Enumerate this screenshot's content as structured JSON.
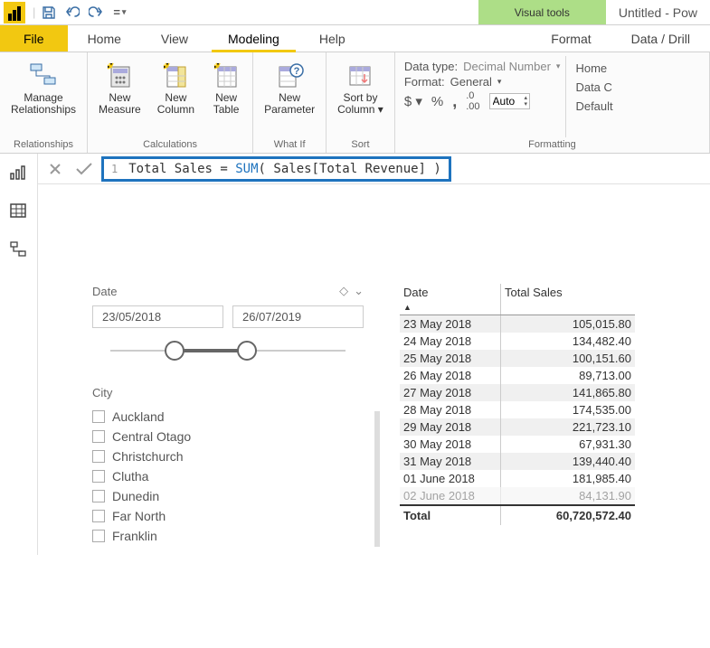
{
  "window": {
    "context_tab": "Visual tools",
    "title": "Untitled - Pow"
  },
  "tabs": {
    "file": "File",
    "home": "Home",
    "view": "View",
    "modeling": "Modeling",
    "help": "Help",
    "format": "Format",
    "datadrill": "Data / Drill"
  },
  "ribbon": {
    "manage_rel": "Manage\nRelationships",
    "new_measure": "New\nMeasure",
    "new_column": "New\nColumn",
    "new_table": "New\nTable",
    "new_param": "New\nParameter",
    "sort_by": "Sort by\nColumn ▾",
    "groups": {
      "relationships": "Relationships",
      "calculations": "Calculations",
      "whatif": "What If",
      "sort": "Sort",
      "formatting": "Formatting"
    },
    "datatype_label": "Data type:",
    "datatype_value": "Decimal Number",
    "format_label": "Format:",
    "format_value": "General",
    "currency": "$ ▾",
    "percent": "%",
    "comma": ",",
    "decimal_icon": ".00",
    "decimal_value": "Auto",
    "prop": {
      "home": "Home",
      "datac": "Data C",
      "default": "Default"
    }
  },
  "formula": {
    "line": "1",
    "measure": "Total Sales",
    "eq": " = ",
    "func": "SUM",
    "args": "( Sales[Total Revenue] )"
  },
  "date_slicer": {
    "title": "Date",
    "start": "23/05/2018",
    "end": "26/07/2019"
  },
  "city_slicer": {
    "title": "City",
    "items": [
      "Auckland",
      "Central Otago",
      "Christchurch",
      "Clutha",
      "Dunedin",
      "Far North",
      "Franklin"
    ]
  },
  "table": {
    "col1": "Date",
    "col2": "Total Sales",
    "rows": [
      [
        "23 May 2018",
        "105,015.80"
      ],
      [
        "24 May 2018",
        "134,482.40"
      ],
      [
        "25 May 2018",
        "100,151.60"
      ],
      [
        "26 May 2018",
        "89,713.00"
      ],
      [
        "27 May 2018",
        "141,865.80"
      ],
      [
        "28 May 2018",
        "174,535.00"
      ],
      [
        "29 May 2018",
        "221,723.10"
      ],
      [
        "30 May 2018",
        "67,931.30"
      ],
      [
        "31 May 2018",
        "139,440.40"
      ],
      [
        "01 June 2018",
        "181,985.40"
      ],
      [
        "02 June 2018",
        "84,131.90"
      ]
    ],
    "total_label": "Total",
    "total_value": "60,720,572.40"
  }
}
